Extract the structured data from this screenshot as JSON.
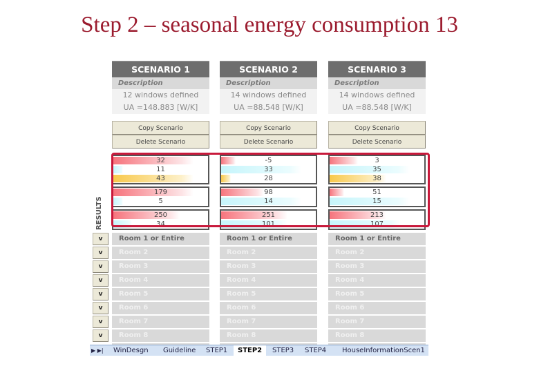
{
  "slide": {
    "title": "Step 2 – seasonal energy consumption 13"
  },
  "colors": {
    "title": "#9b1b2e",
    "highlight_frame": "#c8193b",
    "header_bg": "#6e6e6e",
    "bar_red": "#f6747d",
    "bar_cyan": "#c6f5fb",
    "bar_yellow": "#f8c94c"
  },
  "results_label": "RESULTS",
  "scenarios": [
    {
      "header": "SCENARIO 1",
      "description_label": "Description",
      "description_lines": [
        "12 windows defined",
        "UA =148.883 [W/K]"
      ],
      "copy_label": "Copy Scenario",
      "delete_label": "Delete Scenario",
      "results": [
        [
          {
            "value": "32",
            "kind": "red",
            "fill": 0.85
          },
          {
            "value": "11",
            "kind": "cyan",
            "fill": 0.1
          },
          {
            "value": "43",
            "kind": "yellow",
            "fill": 0.85
          }
        ],
        [
          {
            "value": "179",
            "kind": "red",
            "fill": 0.85
          },
          {
            "value": "5",
            "kind": "cyan",
            "fill": 0.1
          }
        ],
        [
          {
            "value": "250",
            "kind": "red",
            "fill": 0.7
          },
          {
            "value": "34",
            "kind": "cyan",
            "fill": 0.2
          }
        ]
      ],
      "rooms": [
        "Room 1 or Entire House",
        "Room 2",
        "Room 3",
        "Room 4",
        "Room 5",
        "Room 6",
        "Room 7",
        "Room 8"
      ]
    },
    {
      "header": "SCENARIO 2",
      "description_label": "Description",
      "description_lines": [
        "14 windows defined",
        "UA =88.548 [W/K]"
      ],
      "copy_label": "Copy Scenario",
      "delete_label": "Delete Scenario",
      "results": [
        [
          {
            "value": "-5",
            "kind": "red",
            "fill": 0.15
          },
          {
            "value": "33",
            "kind": "cyan",
            "fill": 0.85
          },
          {
            "value": "28",
            "kind": "yellow",
            "fill": 0.1
          }
        ],
        [
          {
            "value": "98",
            "kind": "red",
            "fill": 0.45
          },
          {
            "value": "14",
            "kind": "cyan",
            "fill": 0.85
          }
        ],
        [
          {
            "value": "251",
            "kind": "red",
            "fill": 0.7
          },
          {
            "value": "101",
            "kind": "cyan",
            "fill": 0.7
          }
        ]
      ],
      "rooms": [
        "Room 1 or Entire House",
        "Room 2",
        "Room 3",
        "Room 4",
        "Room 5",
        "Room 6",
        "Room 7",
        "Room 8"
      ]
    },
    {
      "header": "SCENARIO 3",
      "description_label": "Description",
      "description_lines": [
        "14 windows defined",
        "UA =88.548 [W/K]"
      ],
      "copy_label": "Copy Scenario",
      "delete_label": "Delete Scenario",
      "results": [
        [
          {
            "value": "3",
            "kind": "red",
            "fill": 0.3
          },
          {
            "value": "35",
            "kind": "cyan",
            "fill": 0.85
          },
          {
            "value": "38",
            "kind": "yellow",
            "fill": 0.6
          }
        ],
        [
          {
            "value": "51",
            "kind": "red",
            "fill": 0.15
          },
          {
            "value": "15",
            "kind": "cyan",
            "fill": 0.85
          }
        ],
        [
          {
            "value": "213",
            "kind": "red",
            "fill": 0.6
          },
          {
            "value": "107",
            "kind": "cyan",
            "fill": 0.75
          }
        ]
      ],
      "rooms": [
        "Room 1 or Entire House",
        "Room 2",
        "Room 3",
        "Room 4",
        "Room 5",
        "Room 6",
        "Room 7",
        "Room 8"
      ]
    }
  ],
  "room_expand_label": "v",
  "sheet_tabs": {
    "nav": "▶ ▶|",
    "items": [
      {
        "label": "WinDesgn",
        "active": false
      },
      {
        "label": "Guideline",
        "active": false
      },
      {
        "label": "STEP1",
        "active": false
      },
      {
        "label": "STEP2",
        "active": true
      },
      {
        "label": "STEP3",
        "active": false
      },
      {
        "label": "STEP4",
        "active": false
      },
      {
        "label": "HouseInformationScen1",
        "active": false
      }
    ]
  }
}
